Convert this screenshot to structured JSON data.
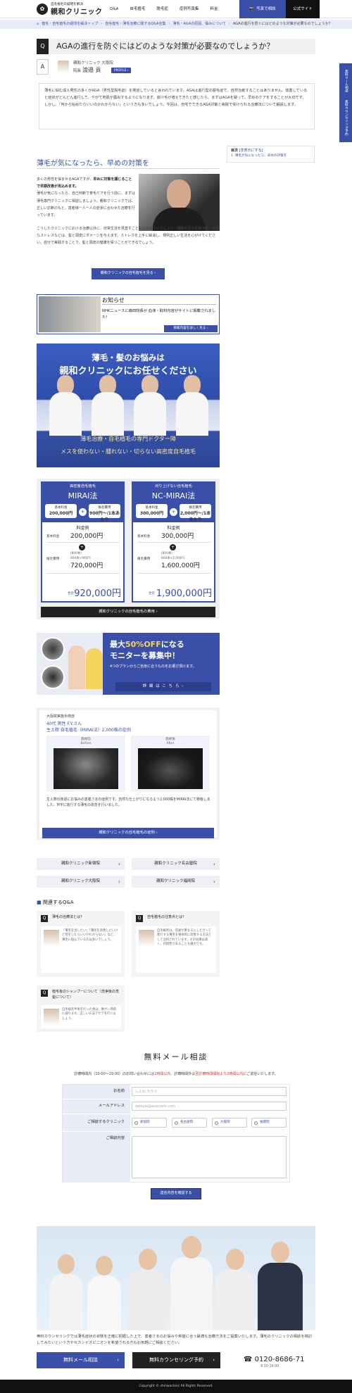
{
  "header": {
    "logo_sub": "自毛植毛の疑問を解決",
    "logo_main": "親和クリニック",
    "nav": [
      "Q&A",
      "自毛植毛",
      "脱毛症",
      "症例写真集",
      "料金"
    ],
    "photo_label": "写真で相談",
    "official_label": "公式サイト"
  },
  "breadcrumb": {
    "items": [
      "植毛・自毛植毛の疑問を解決トップ",
      "自毛植毛・薄毛治療に関するQ&A全集",
      "薄毛・AGAの原因、悩みについて"
    ],
    "current": "AGAの進行を防ぐにはどのような対策が必要なのでしょうか？"
  },
  "question": {
    "q_mark": "Q",
    "title": "AGAの進行を防ぐにはどのような対策が必要なのでしょうか？",
    "a_mark": "A"
  },
  "doctor": {
    "clinic": "親和クリニック 大阪院",
    "role": "院長",
    "name": "渡邉 貢",
    "profile_btn": "PROFILE ›"
  },
  "answer_text": "薄毛に悩む成人男性の多くがAGA（男性型脱毛症）を発症していると言われています。AGAは進行型の脱毛症で、自然治癒することはありません。放置していると症状がどんどん進行して、やがて地肌が露出するようになります。抜け毛が増えてきたと感じたら、まずはAGAを疑って、早めのケアをすることが大切です。しかし、「何から始めたらいいのかわからない」という方も多いでしょう。今回は、自宅でできるAGA対策と病院で受けられる治療法について解説します。",
  "section": {
    "title": "薄毛が気になったら、早めの対策を",
    "lead": "多くの男性を悩ませるAGAですが、",
    "lead_bold": "早めに対策を講じることで早期改善が見込めます。",
    "body1": "薄毛が気になったら、自己判断で育毛ケアを行う前に、まずは薄毛専門クリニックに相談しましょう。親和クリニックでは、正しい診断のもと、患者様一人一人の症状に合わせた治療を行っています。",
    "body2": "こうしたクリニックにおける治療以外に、日常生活を見直すことも欠かせないでしょう。睡眠不足や栄養不足、過度なストレスなどは、髪と頭皮にダメージを与えます。ストレスを上手に解消し、規則正しい生活を心がけてください。自分で実践することで、髪と頭皮の健康を保つことができるでしょう。",
    "cta": "親和クリニックの自毛植毛を見る ›"
  },
  "toc": {
    "title": "目次",
    "toggle": "[非表示にする]",
    "item": "1. 薄毛が気になったら、早めの対策を"
  },
  "float_tab": {
    "mail": "無料メール相談",
    "reserve": "無料カウンセリング予約"
  },
  "notice": {
    "title": "お知らせ",
    "text": "NHKニュースに森田院長が 血液・取材内容がサイトに掲載されました！",
    "btn": "掲載内容を詳しく見る ›"
  },
  "banner": {
    "line1": "薄毛・髪のお悩みは",
    "line2": "親和クリニックにお任せください",
    "sub1": "薄毛治療・自毛植毛の専門ドクター陣",
    "sub2": "メスを使わない・腫れない・切らない高密度自毛植毛"
  },
  "plans": [
    {
      "sub": "高密度自毛植毛",
      "name": "MIRAI法",
      "base_label": "基本料金",
      "base": "200,000円",
      "graft_label": "植毛費用",
      "graft": "900円〜/1本あたり",
      "fee_title": "料金例",
      "row1_label": "基本料金",
      "row1_val": "200,000円",
      "row2_label": "植毛費用",
      "row2_note1": "(800本)",
      "row2_note2": "800本×900円",
      "row2_val": "720,000円",
      "total_label": "合計",
      "total": "920,000円"
    },
    {
      "sub": "刈り上げない自毛植毛",
      "name": "NC-MIRAI法",
      "base_label": "基本料金",
      "base": "300,000円",
      "graft_label": "植毛費用",
      "graft": "2,000円〜/1本あたり",
      "fee_title": "料金例",
      "row1_label": "基本料金",
      "row1_val": "300,000円",
      "row2_label": "植毛費用",
      "row2_note1": "(800本)",
      "row2_note2": "800本×2,000円",
      "row2_val": "1,600,000円",
      "total_label": "合計",
      "total": "1,900,000円"
    }
  ],
  "plans_btn": "親和クリニックの自毛植毛の費用 ›",
  "monitor": {
    "line1a": "最大",
    "line1b": "50%OFF",
    "line1c": "になる",
    "line2": "モニターを募集中！",
    "line3": "4つのプランからご自身に合うものをお選び頂けます。",
    "btn": "詳 細 は こ ち ら ›"
  },
  "case": {
    "clinic": "大阪院実施手術症",
    "age": "40代 男性 F.Y.さん",
    "plan": "生え際 自毛植毛（MIRAI法）2,000株の症例",
    "before": "施術前",
    "before_en": "Before",
    "after": "施術後",
    "after_en": "After",
    "text": "生え際の後退にお悩みの患者さまの症例です。自然な仕上がりになるよう2,000株をMIRAI法にて移植しました。M字に進行する薄毛の改善を行いました。",
    "btn": "親和クリニックの自毛植毛の症例 ›"
  },
  "clinics": [
    "親和クリニック新宿院",
    "親和クリニック名古屋院",
    "親和クリニック大阪院",
    "親和クリニック福岡院"
  ],
  "related": {
    "title": "関連するQ&A",
    "items": [
      {
        "q": "Q",
        "title": "薄毛の治療法とは？",
        "answer": "「薄毛を治したい」「薄毛を改善したいけど何をしたらいいかわからない」など、薄毛に悩んでいる方は多いでしょう。"
      },
      {
        "q": "Q",
        "title": "自毛植毛の注意点とは？",
        "answer": "自毛植毛は、年齢が重なるにしたがって進行する薄毛を根本的に改善する方法として注目されています。その効果は高く、持続性があることも魅力です。"
      },
      {
        "q": "Q",
        "title": "植毛後のシャンプーについて（洗浄後の洗髪について）",
        "answer": "自毛植毛手術を行った後は、数が一時的に減ります。正しい方法でケアを行いましょう。"
      }
    ]
  },
  "form": {
    "title": "無料メール相談",
    "note_a": "診療時間内（10:00〜19:00）のお問い合わせには",
    "note_b": "1時間以内",
    "note_c": "、診療時間外は",
    "note_d": "翌診療時間開始より2時間以内",
    "note_e": "にご返信いたします。",
    "name_label": "お名前",
    "name_ph": "しんわ たろう",
    "email_label": "メールアドレス",
    "email_ph": "sample@example.com",
    "clinic_label": "ご相談するクリニック",
    "clinic_options": [
      "新宿院",
      "名古屋院",
      "大阪院",
      "福岡院"
    ],
    "content_label": "ご相談内容",
    "submit": "送信内容を確認する"
  },
  "footer_cta": {
    "text": "無料カウンセリングでは薄毛症状の状態を正確に把握した上で、患者さまのお悩みや希望に合う最適な治療方法をご提案いたします。薄毛のクリニックの相談を検討してみたいという方やセカンドオピニオンを希望される方もお気軽にご相談ください。",
    "mail_btn": "無料メール相談",
    "counseling_btn": "無料カウンセリング予約",
    "tel": "0120-8686-71",
    "hours": "9:30-19:00"
  },
  "copyright": "Copyright © shinwaclinic All Rights Reserved.",
  "colors": {
    "accent": "#3a4fa8",
    "dark": "#222222"
  }
}
